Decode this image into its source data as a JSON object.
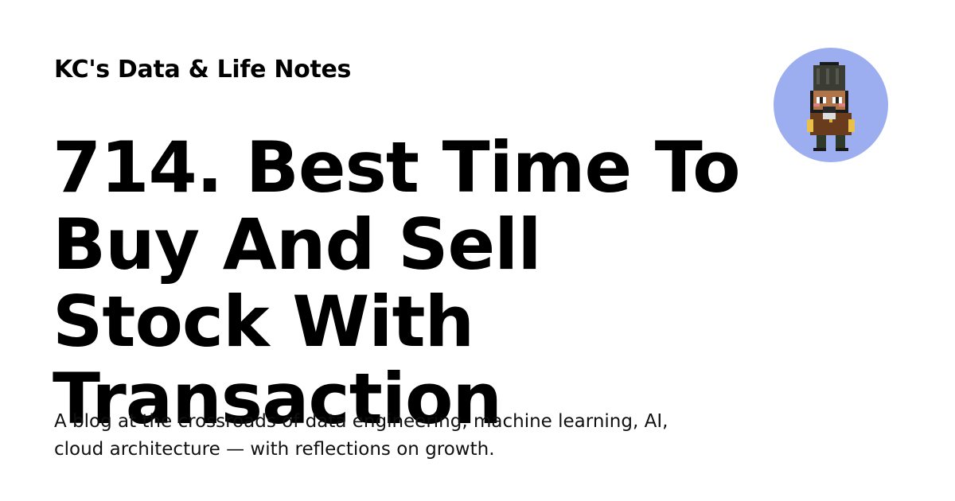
{
  "site_name": "KC's Data & Life Notes",
  "post_title": "714. Best Time To Buy And Sell Stock With Transaction",
  "description": "A blog at the crossroads of data engineering, machine learning, AI, cloud architecture — with reflections on growth.",
  "avatar": {
    "icon": "pixel-art-character-avatar",
    "background": "#9caef0"
  }
}
